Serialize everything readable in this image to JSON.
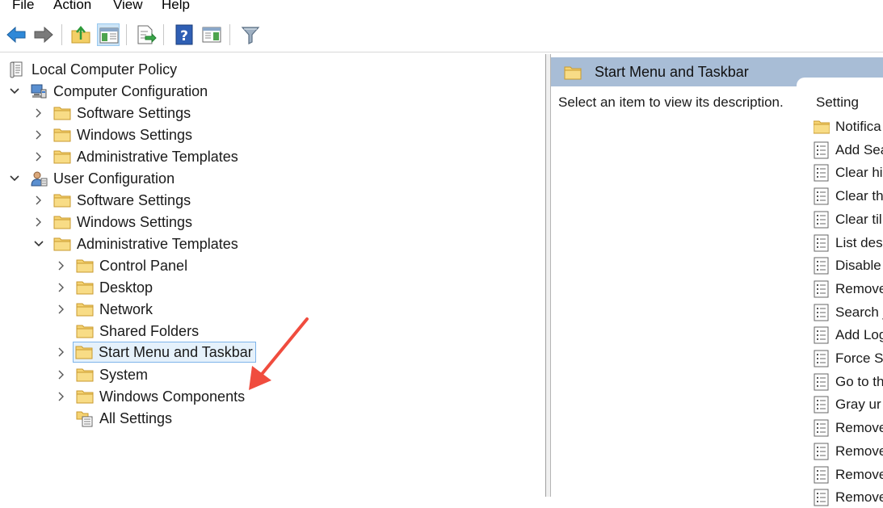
{
  "menu": [
    "File",
    "Action",
    "View",
    "Help"
  ],
  "toolbar": {
    "buttons": [
      "back-icon",
      "forward-icon",
      "up-folder-icon",
      "show-hide-tree-icon",
      "export-list-icon",
      "help-icon",
      "show-action-pane-icon",
      "filter-icon"
    ]
  },
  "tree": {
    "root": "Local Computer Policy",
    "computer_configuration": {
      "label": "Computer Configuration",
      "children": [
        "Software Settings",
        "Windows Settings",
        "Administrative Templates"
      ]
    },
    "user_configuration": {
      "label": "User Configuration",
      "children": [
        "Software Settings",
        "Windows Settings",
        "Administrative Templates"
      ],
      "admin_templates_children": [
        "Control Panel",
        "Desktop",
        "Network",
        "Shared Folders",
        "Start Menu and Taskbar",
        "System",
        "Windows Components",
        "All Settings"
      ]
    },
    "selected": "Start Menu and Taskbar"
  },
  "details": {
    "header_title": "Start Menu and Taskbar",
    "description": "Select an item to view its description.",
    "column_header": "Setting",
    "settings": [
      "Notifica",
      "Add Sea",
      "Clear hi",
      "Clear th",
      "Clear til",
      "List des",
      "Disable",
      "Remove",
      "Search j",
      "Add Log",
      "Force St",
      "Go to th",
      "Gray ur",
      "Remove",
      "Remove",
      "Remove",
      "Remove"
    ]
  },
  "colors": {
    "header_bg": "#a8bdd6",
    "selection_bg": "#e5f1fb",
    "selection_border": "#7eb4ea",
    "annotation_arrow": "#f04c3e"
  }
}
